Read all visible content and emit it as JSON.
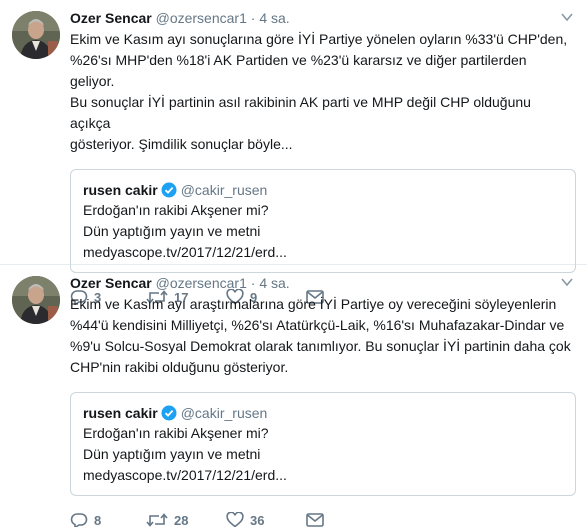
{
  "tweets": [
    {
      "author_name": "Ozer Sencar",
      "handle": "@ozersencar1",
      "separator": "·",
      "time": "4 sa.",
      "lines": [
        "Ekim ve Kasım ayı sonuçlarına göre İYİ Partiye yönelen oyların %33'ü CHP'den,",
        "%26'sı MHP'den %18'i AK Partiden ve %23'ü kararsız ve diğer partilerden geliyor.",
        "Bu sonuçlar İYİ partinin asıl rakibinin AK parti ve MHP değil  CHP olduğunu açıkça",
        "gösteriyor. Şimdilik sonuçlar böyle..."
      ],
      "quote": {
        "name": "rusen cakir",
        "handle": "@cakir_rusen",
        "lines": [
          "Erdoğan'ın rakibi Akşener mi?",
          "Dün yaptığım yayın ve metni",
          "medyascope.tv/2017/12/21/erd..."
        ]
      },
      "replies": "3",
      "retweets": "17",
      "likes": "9"
    },
    {
      "author_name": "Ozer Sencar",
      "handle": "@ozersencar1",
      "separator": "·",
      "time": "4 sa.",
      "lines": [
        "Ekim ve Kasım ayı araştırmalarına göre İYİ Partiye oy vereceğini söyleyenlerin",
        "%44'ü kendisini Milliyetçi, %26'sı Atatürkçü-Laik, %16'sı Muhafazakar-Dindar ve",
        "%9'u Solcu-Sosyal Demokrat olarak  tanımlıyor. Bu sonuçlar İYİ partinin daha çok",
        "CHP'nin rakibi olduğunu gösteriyor."
      ],
      "quote": {
        "name": "rusen cakir",
        "handle": "@cakir_rusen",
        "lines": [
          "Erdoğan'ın rakibi Akşener mi?",
          "Dün yaptığım yayın ve metni",
          "medyascope.tv/2017/12/21/erd..."
        ]
      },
      "replies": "8",
      "retweets": "28",
      "likes": "36"
    }
  ],
  "icons": {
    "verified": "verified-badge-icon",
    "reply": "reply-icon",
    "retweet": "retweet-icon",
    "like": "heart-icon",
    "message": "envelope-icon",
    "menu": "chevron-down-icon"
  },
  "colors": {
    "text": "#14171a",
    "muted": "#657786",
    "verified": "#1da1f2",
    "border": "#ccd6dd"
  }
}
